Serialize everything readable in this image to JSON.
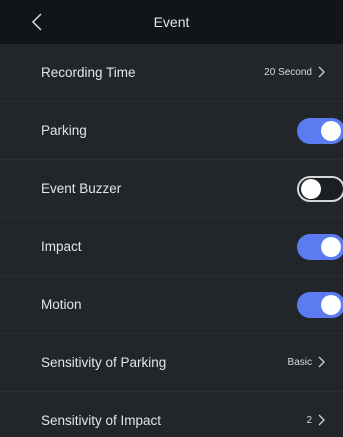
{
  "header": {
    "title": "Event"
  },
  "rows": [
    {
      "label": "Recording Time",
      "value": "20 Second"
    },
    {
      "label": "Parking",
      "toggle": "on"
    },
    {
      "label": "Event Buzzer",
      "toggle": "off"
    },
    {
      "label": "Impact",
      "toggle": "on"
    },
    {
      "label": "Motion",
      "toggle": "on"
    },
    {
      "label": "Sensitivity of Parking",
      "value": "Basic"
    },
    {
      "label": "Sensitivity of Impact",
      "value": "2"
    }
  ],
  "colors": {
    "toggle_on": "#5b7cf0",
    "background": "#22262b",
    "header_background": "#111418"
  }
}
